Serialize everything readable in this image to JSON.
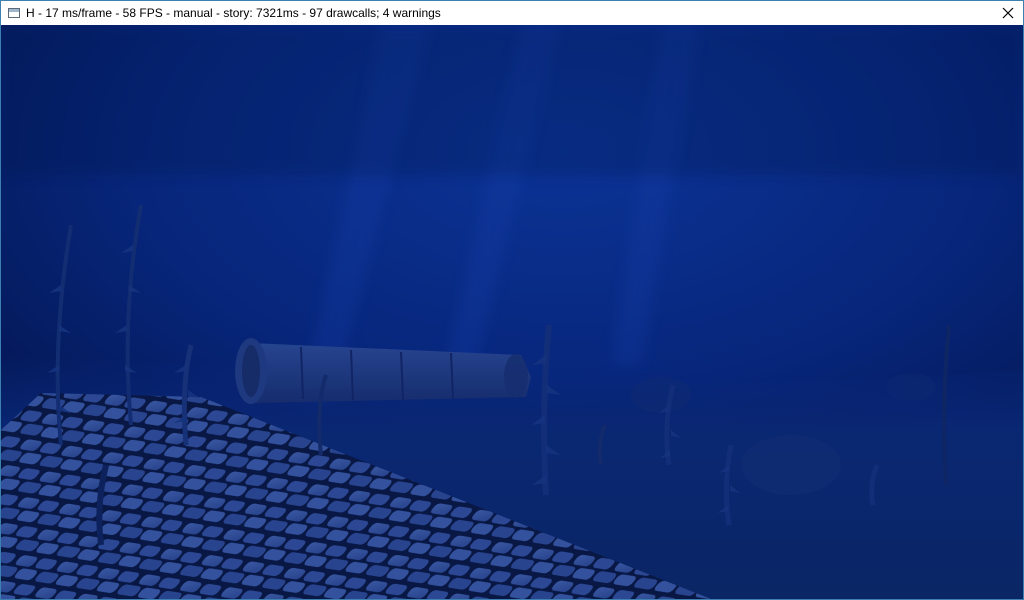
{
  "window": {
    "title": "H - 17 ms/frame - 58 FPS - manual - story: 7321ms - 97 drawcalls; 4 warnings",
    "icon": "application-window-icon",
    "close_icon": "close-icon"
  },
  "scene": {
    "description_icon": "underwater-3d-scene",
    "colors": {
      "water_top": "#0a2a8a",
      "water_dark": "#061a5a",
      "seabed": "#0b2a6e",
      "tiles": "#4a6fc8",
      "grout": "#0a1840"
    }
  }
}
